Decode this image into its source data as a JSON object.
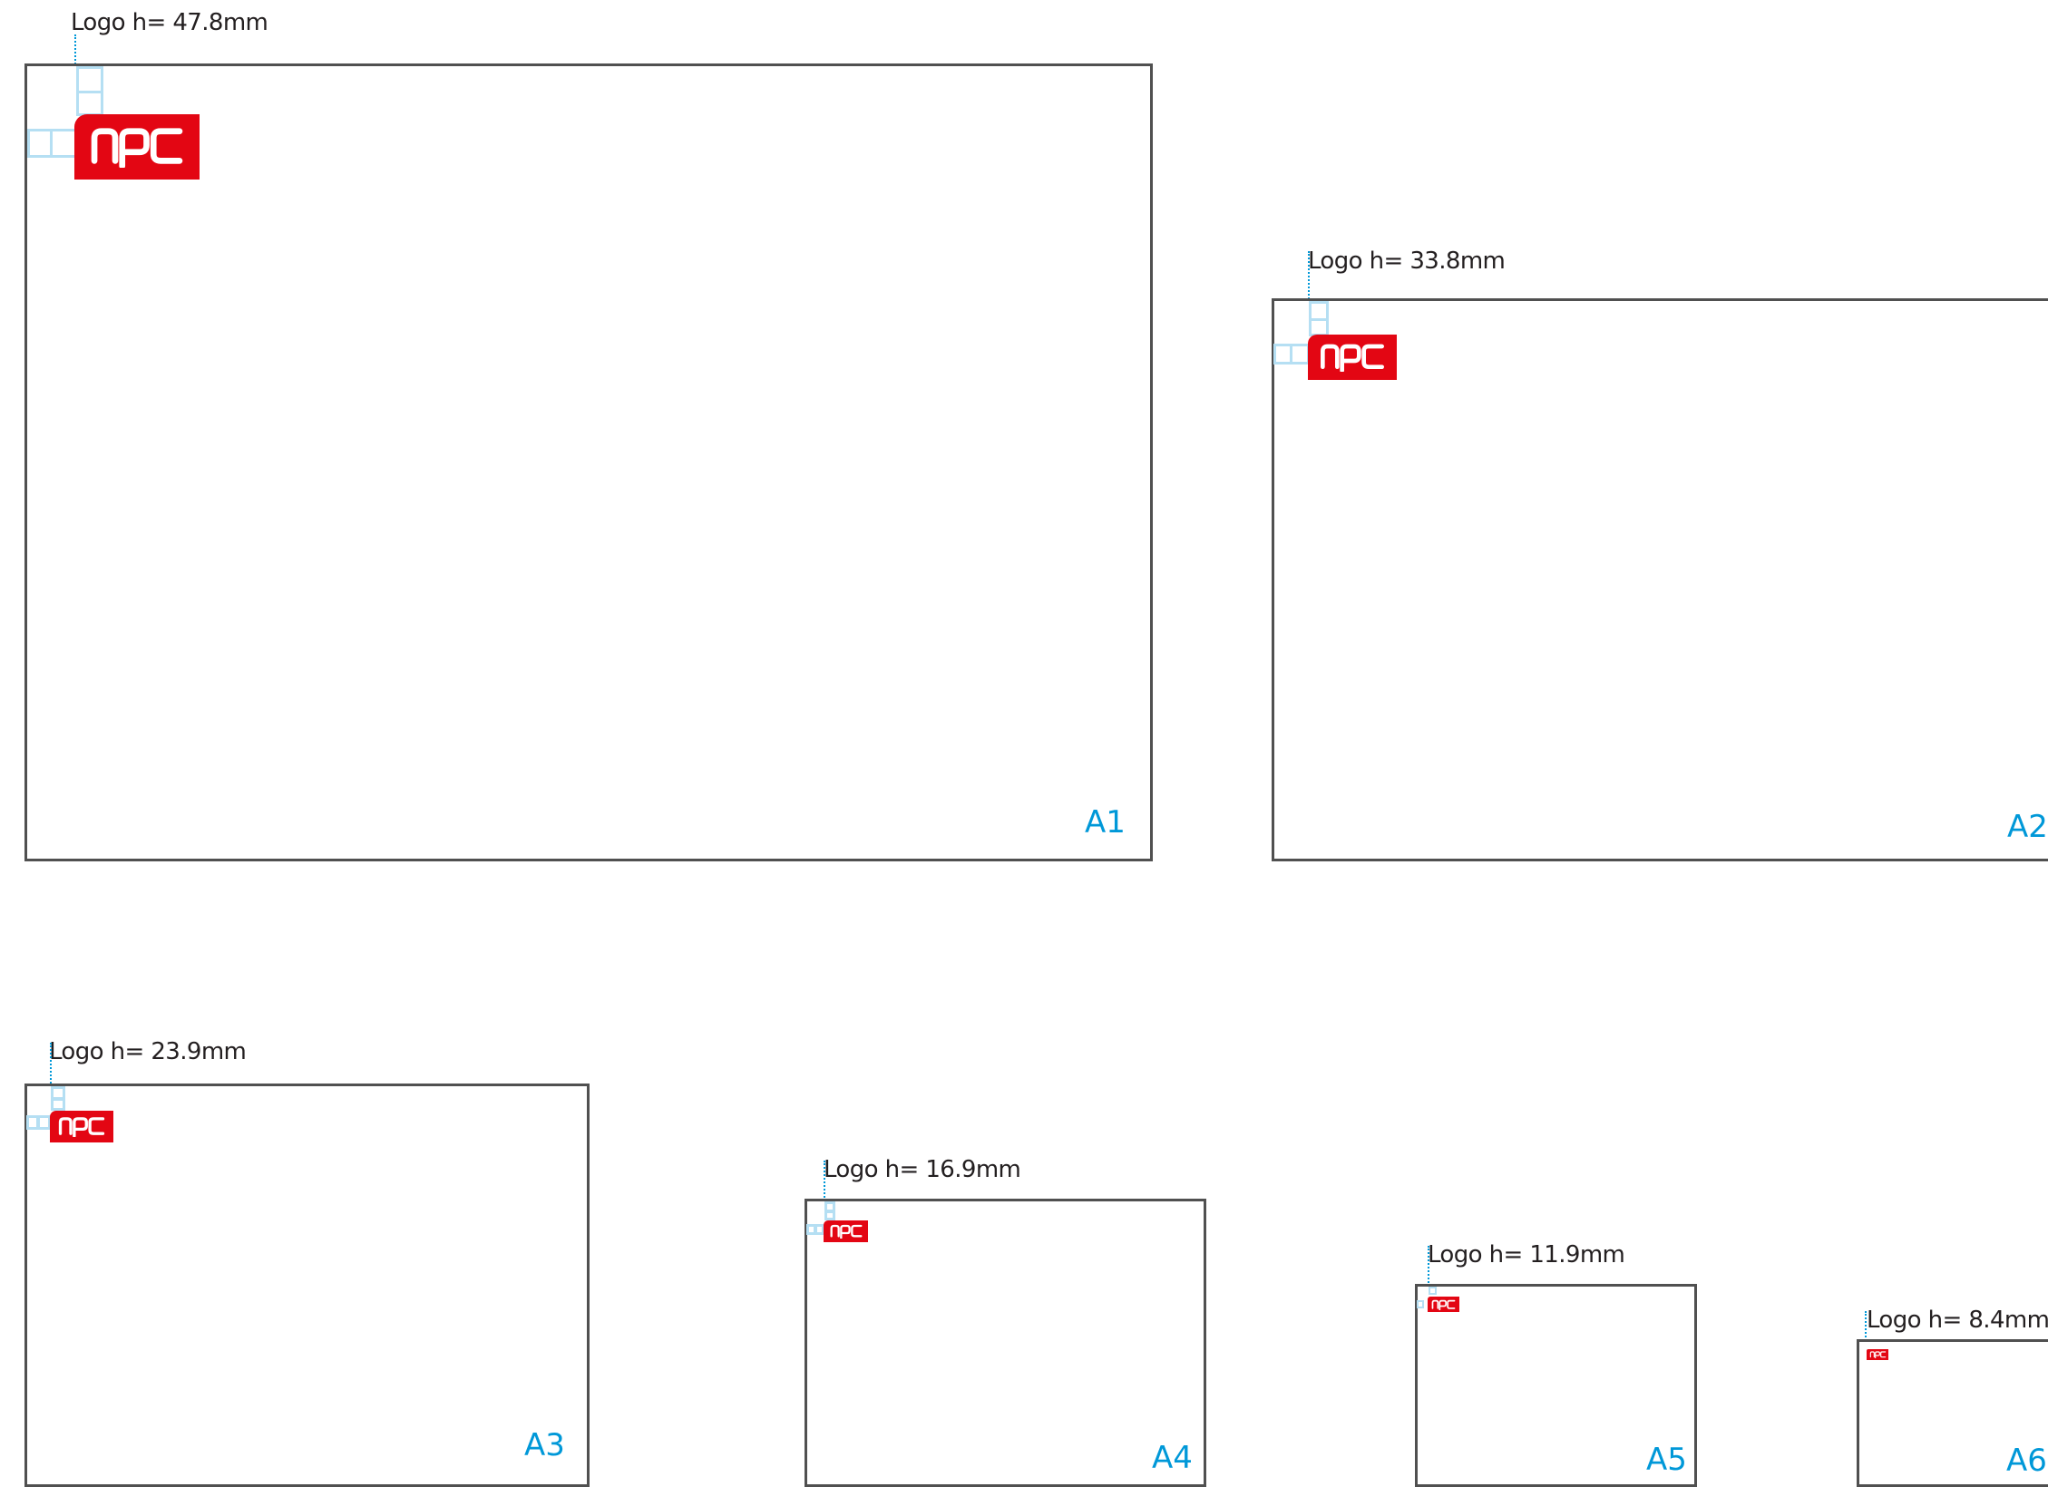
{
  "brand": {
    "logo_text": "npc",
    "logo_color": "#e30613",
    "guide_color": "#b5dff3",
    "dim_color": "#0098d8",
    "frame_color": "#505050"
  },
  "formats": [
    {
      "size": "A1",
      "logo_label": "Logo h= 47.8mm"
    },
    {
      "size": "A2",
      "logo_label": "Logo h= 33.8mm"
    },
    {
      "size": "A3",
      "logo_label": "Logo h= 23.9mm"
    },
    {
      "size": "A4",
      "logo_label": "Logo h= 16.9mm"
    },
    {
      "size": "A5",
      "logo_label": "Logo h= 11.9mm"
    },
    {
      "size": "A6",
      "logo_label": "Logo h= 8.4mm"
    }
  ]
}
